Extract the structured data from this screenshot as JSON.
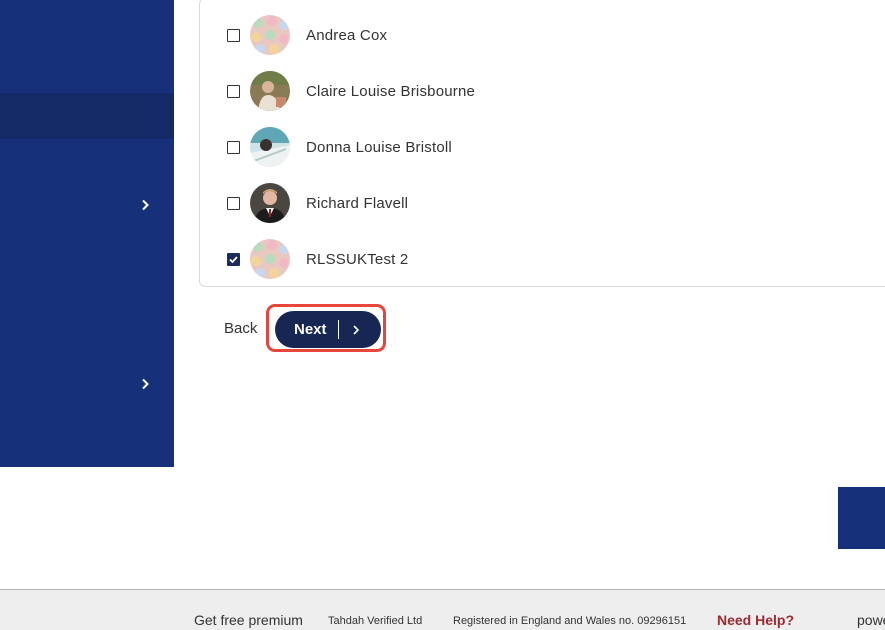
{
  "members": [
    {
      "name": "Andrea Cox",
      "checked": false,
      "avatar": "patterned-avatar"
    },
    {
      "name": "Claire Louise Brisbourne",
      "checked": false,
      "avatar": "photo-avatar"
    },
    {
      "name": "Donna Louise Bristoll",
      "checked": false,
      "avatar": "photo-avatar"
    },
    {
      "name": "Richard Flavell",
      "checked": false,
      "avatar": "photo-avatar"
    },
    {
      "name": "RLSSUKTest 2",
      "checked": true,
      "avatar": "patterned-avatar"
    }
  ],
  "actions": {
    "back_label": "Back",
    "next_label": "Next"
  },
  "footer": {
    "premium": "Get free premium",
    "company": "Tahdah Verified Ltd",
    "registered": "Registered in England and Wales no. 09296151",
    "help": "Need Help?",
    "powered": "powe"
  },
  "colors": {
    "sidebar": "#17307a",
    "button": "#172653",
    "highlight": "#e8463c",
    "help": "#9b2a32"
  }
}
